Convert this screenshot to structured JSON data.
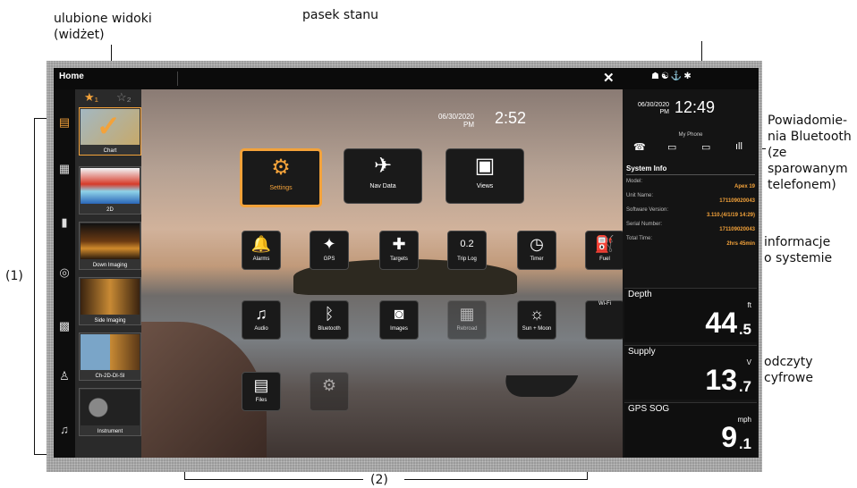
{
  "annotations": {
    "favorite_views": "ulubione widoki\n(widżet)",
    "status_bar": "pasek stanu",
    "bluetooth_notifications": "Powiadomie-\nnia Bluetooth\n(ze\nsparowanym\ntelefonem)",
    "system_info": "informacje\no systemie",
    "digital_readouts": "odczyty\ncyfrowe",
    "label_1": "(1)",
    "label_2": "(2)"
  },
  "topbar": {
    "title": "Home",
    "close_icon": "close-icon",
    "status_icons": "☗☯⚓✱"
  },
  "leftnav": {
    "items": [
      "layers-icon",
      "78-icon",
      "bottle-icon",
      "nav-icon",
      "grid-icon",
      "person-icon",
      "music-icon"
    ]
  },
  "favorites": {
    "tab_1": "★₁",
    "tab_2": "☆₂",
    "items": [
      {
        "label": "Chart"
      },
      {
        "label": "2D"
      },
      {
        "label": "Down Imaging"
      },
      {
        "label": "Side Imaging"
      },
      {
        "label": "Ch-2D-DI-SI"
      },
      {
        "label": "Instrument"
      }
    ]
  },
  "main": {
    "date": "06/30/2020\nPM",
    "time": "2:52",
    "big_tiles": [
      {
        "label": "Settings",
        "icon": "⚙"
      },
      {
        "label": "Nav Data",
        "icon": "✈"
      },
      {
        "label": "Views",
        "icon": "▣"
      }
    ],
    "tiles": [
      {
        "label": "Alarms",
        "icon": "🔔"
      },
      {
        "label": "GPS",
        "icon": "✦"
      },
      {
        "label": "Targets",
        "icon": "✚"
      },
      {
        "label": "Trip Log",
        "icon": "0.2"
      },
      {
        "label": "Timer",
        "icon": "◷"
      },
      {
        "label": "Fuel",
        "icon": "⛽"
      },
      {
        "label": "Audio",
        "icon": "♫"
      },
      {
        "label": "Bluetooth",
        "icon": "ᛒ"
      },
      {
        "label": "Images",
        "icon": "◙"
      },
      {
        "label": "Rebroad",
        "icon": "▦"
      },
      {
        "label": "Sun + Moon",
        "icon": "☼"
      },
      {
        "label": "Wi-Fi",
        "icon": ""
      },
      {
        "label": "Files",
        "icon": "▤"
      },
      {
        "label": "",
        "icon": "⚙"
      }
    ]
  },
  "right": {
    "date": "06/30/2020\nPM",
    "time": "12:49",
    "phone_name": "My Phone",
    "phone_icons": [
      "☎",
      "▭",
      "▭",
      "ıll"
    ],
    "sysinfo": {
      "title": "System Info",
      "rows": [
        {
          "key": "Model:",
          "value": "Apex 19"
        },
        {
          "key": "Unit Name:",
          "value": "171109020043"
        },
        {
          "key": "Software Version:",
          "value": "3.110.(4/1/19 14:29)"
        },
        {
          "key": "Serial Number:",
          "value": "171109020043"
        },
        {
          "key": "Total Time:",
          "value": "2hrs 45min"
        }
      ]
    },
    "readings": [
      {
        "name": "Depth",
        "unit": "ft",
        "value": "44",
        "decimal": ".5"
      },
      {
        "name": "Supply",
        "unit": "V",
        "value": "13",
        "decimal": ".7"
      },
      {
        "name": "GPS SOG",
        "unit": "mph",
        "value": "9",
        "decimal": ".1"
      }
    ]
  }
}
